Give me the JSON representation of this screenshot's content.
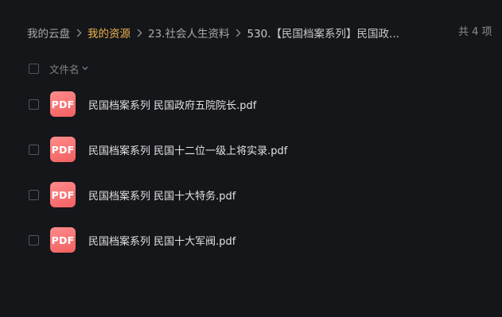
{
  "breadcrumb": {
    "items": [
      {
        "label": "我的云盘"
      },
      {
        "label": "我的资源"
      },
      {
        "label": "23.社会人生资料"
      },
      {
        "label": "530.【民国档案系列】民国政..."
      }
    ],
    "separator_icon": "chevron-right-icon"
  },
  "item_count": "共 4 项",
  "list_header": {
    "name_label": "文件名",
    "sort_icon": "chevron-down-icon"
  },
  "files": [
    {
      "icon_label": "PDF",
      "name": "民国档案系列 民国政府五院院长.pdf"
    },
    {
      "icon_label": "PDF",
      "name": "民国档案系列 民国十二位一级上将实录.pdf"
    },
    {
      "icon_label": "PDF",
      "name": "民国档案系列 民国十大特务.pdf"
    },
    {
      "icon_label": "PDF",
      "name": "民国档案系列 民国十大军阀.pdf"
    }
  ],
  "colors": {
    "background": "#15161a",
    "active_breadcrumb": "#f0b54c",
    "pdf_icon": "#f46a6a"
  }
}
